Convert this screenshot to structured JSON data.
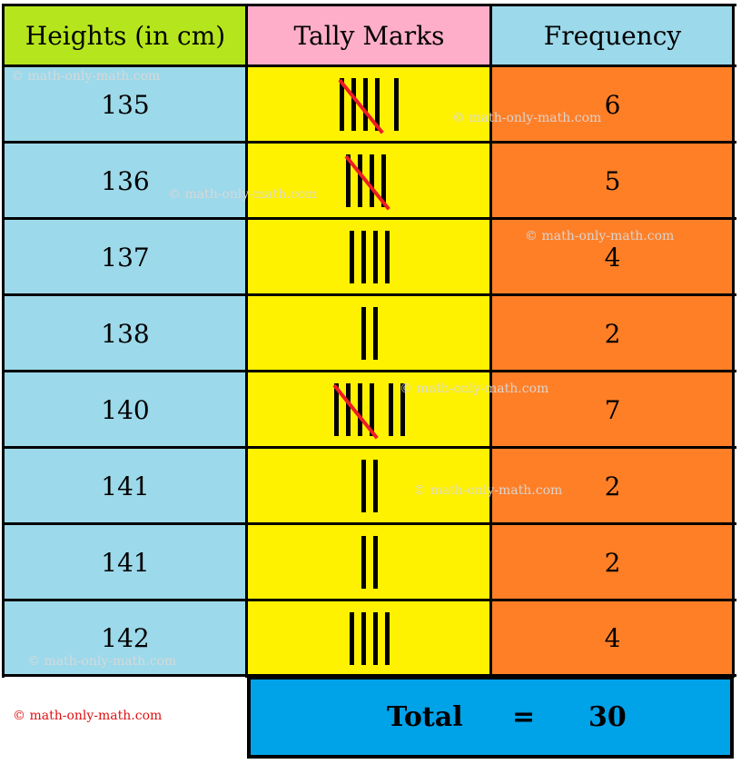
{
  "table": {
    "headers": [
      "Heights (in cm)",
      "Tally Marks",
      "Frequency"
    ],
    "header_colors": [
      "#b5e61d",
      "#ffaec9",
      "#9cd9ea"
    ],
    "rows": [
      {
        "height": "135",
        "tally": 6,
        "frequency": "6"
      },
      {
        "height": "136",
        "tally": 5,
        "frequency": "5"
      },
      {
        "height": "137",
        "tally": 4,
        "frequency": "4"
      },
      {
        "height": "138",
        "tally": 2,
        "frequency": "2"
      },
      {
        "height": "140",
        "tally": 7,
        "frequency": "7"
      },
      {
        "height": "141",
        "tally": 2,
        "frequency": "2"
      },
      {
        "height": "141",
        "tally": 2,
        "frequency": "2"
      },
      {
        "height": "142",
        "tally": 4,
        "frequency": "4"
      }
    ],
    "total": {
      "label": "Total",
      "equals": "=",
      "value": "30"
    }
  },
  "watermark": "© math-only-math.com",
  "credit": "© math-only-math.com",
  "colors": {
    "height_col": "#9cd9ea",
    "tally_col": "#fff200",
    "freq_col": "#ff7f27",
    "total_bg": "#00a2e8",
    "slash": "#ee1c24"
  }
}
